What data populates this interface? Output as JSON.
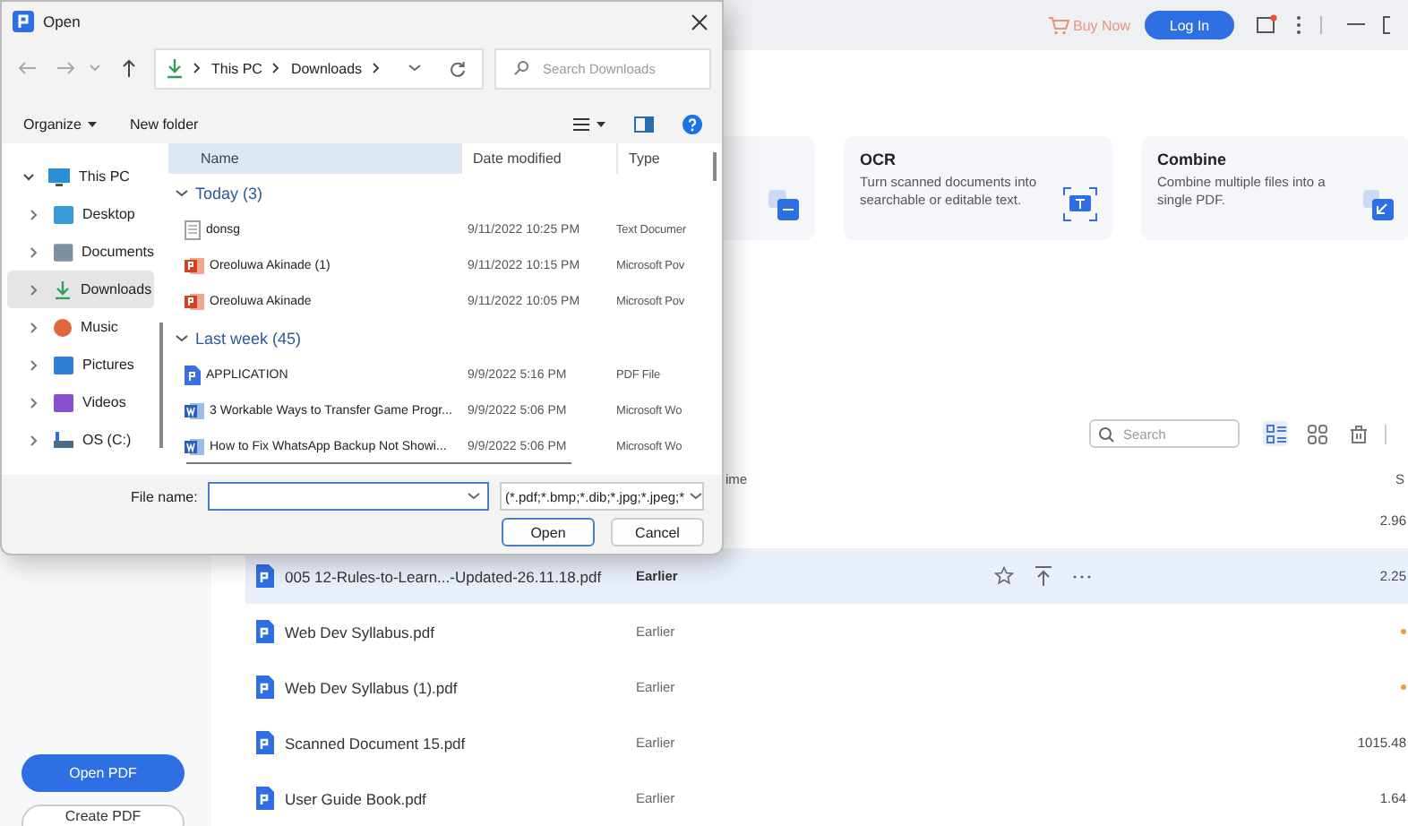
{
  "app": {
    "topbar": {
      "buy_now": "Buy Now",
      "login": "Log In"
    },
    "sidebar_buttons": [
      {
        "label": "Open PDF",
        "kind": "primary"
      },
      {
        "label": "Create PDF",
        "kind": "secondary"
      }
    ],
    "cards": [
      {
        "kind": "convert"
      },
      {
        "title": "OCR",
        "description": "Turn scanned documents into searchable or editable text.",
        "kind": "ocr"
      },
      {
        "title": "Combine",
        "description": "Combine multiple files into a single PDF.",
        "kind": "combine"
      }
    ],
    "search": {
      "placeholder": "Search"
    },
    "view_modes": [
      {
        "kind": "list",
        "selected": true
      },
      {
        "kind": "grid",
        "selected": false
      }
    ],
    "table": {
      "columns": [
        {
          "label": "ime"
        },
        {
          "label": "S"
        }
      ],
      "rows": [
        {
          "size": "2.96",
          "selected": false,
          "marked": false
        },
        {
          "name": "005 12-Rules-to-Learn...-Updated-26.11.18.pdf",
          "time": "Earlier",
          "size": "2.25",
          "selected": true,
          "marked": false
        },
        {
          "name": "Web Dev Syllabus.pdf",
          "time": "Earlier",
          "selected": false,
          "marked": true
        },
        {
          "name": "Web Dev Syllabus (1).pdf",
          "time": "Earlier",
          "selected": false,
          "marked": true
        },
        {
          "name": "Scanned Document 15.pdf",
          "time": "Earlier",
          "size": "1015.48",
          "selected": false,
          "marked": false
        },
        {
          "name": "User Guide Book.pdf",
          "time": "Earlier",
          "size": "1.64",
          "selected": false,
          "marked": false
        }
      ]
    }
  },
  "dialog": {
    "title": "Open",
    "address": [
      "This PC",
      "Downloads"
    ],
    "search": {
      "placeholder": "Search Downloads"
    },
    "toolbar": {
      "organize": "Organize",
      "new_folder": "New folder"
    },
    "nav": [
      {
        "label": "This PC",
        "kind": "pc",
        "expanded": true,
        "selected": false
      },
      {
        "label": "Desktop",
        "kind": "desktop",
        "expanded": false,
        "selected": false
      },
      {
        "label": "Documents",
        "kind": "documents",
        "expanded": false,
        "selected": false
      },
      {
        "label": "Downloads",
        "kind": "downloads",
        "expanded": false,
        "selected": true
      },
      {
        "label": "Music",
        "kind": "music",
        "expanded": false,
        "selected": false
      },
      {
        "label": "Pictures",
        "kind": "pictures",
        "expanded": false,
        "selected": false
      },
      {
        "label": "Videos",
        "kind": "videos",
        "expanded": false,
        "selected": false
      },
      {
        "label": "OS (C:)",
        "kind": "drive",
        "expanded": false,
        "selected": false
      }
    ],
    "columns": [
      {
        "label": "Name",
        "highlighted": true
      },
      {
        "label": "Date modified",
        "highlighted": false
      },
      {
        "label": "Type",
        "highlighted": false
      }
    ],
    "groups": [
      {
        "label": "Today (3)",
        "expanded": true,
        "files": [
          {
            "name": "donsg",
            "date": "9/11/2022 10:25 PM",
            "type": "Text Documer",
            "kind": "text"
          },
          {
            "name": "Oreoluwa Akinade (1)",
            "date": "9/11/2022 10:15 PM",
            "type": "Microsoft Pov",
            "kind": "ppt"
          },
          {
            "name": "Oreoluwa Akinade",
            "date": "9/11/2022 10:05 PM",
            "type": "Microsoft Pov",
            "kind": "ppt"
          }
        ]
      },
      {
        "label": "Last week (45)",
        "expanded": true,
        "files": [
          {
            "name": "APPLICATION",
            "date": "9/9/2022 5:16 PM",
            "type": "PDF File",
            "kind": "pdf"
          },
          {
            "name": "3 Workable Ways to Transfer Game Progr...",
            "date": "9/9/2022 5:06 PM",
            "type": "Microsoft Wo",
            "kind": "word"
          },
          {
            "name": "How to Fix WhatsApp Backup Not Showi...",
            "date": "9/9/2022 5:06 PM",
            "type": "Microsoft Wo",
            "kind": "word"
          }
        ]
      }
    ],
    "file_name_label": "File name:",
    "filter": "(*.pdf;*.bmp;*.dib;*.jpg;*.jpeg;*",
    "buttons": [
      {
        "label": "Open",
        "kind": "default"
      },
      {
        "label": "Cancel",
        "kind": "normal"
      }
    ]
  }
}
